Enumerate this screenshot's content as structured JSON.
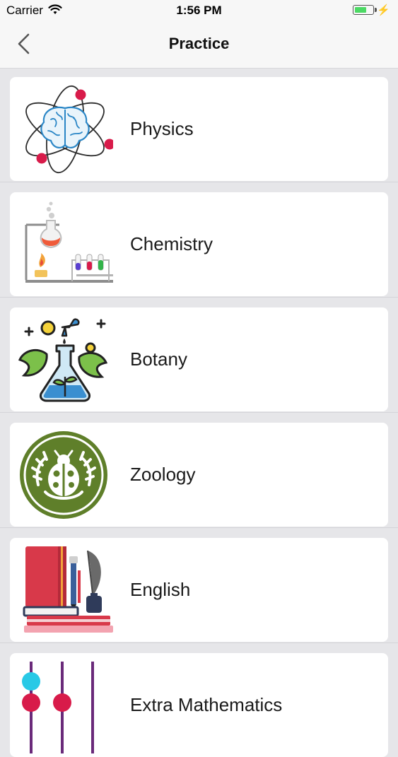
{
  "status_bar": {
    "carrier": "Carrier",
    "time": "1:56 PM"
  },
  "nav": {
    "title": "Practice"
  },
  "subjects": [
    {
      "label": "Physics",
      "icon": "atom-brain-icon"
    },
    {
      "label": "Chemistry",
      "icon": "lab-flask-icon"
    },
    {
      "label": "Botany",
      "icon": "plant-flask-icon"
    },
    {
      "label": "Zoology",
      "icon": "ladybug-emblem-icon"
    },
    {
      "label": "English",
      "icon": "books-quill-icon"
    },
    {
      "label": "Extra Mathematics",
      "icon": "abacus-icon"
    }
  ],
  "colors": {
    "zoology_green": "#5f7f2a",
    "accent_red": "#d81b4a",
    "background": "#e6e6e9"
  }
}
